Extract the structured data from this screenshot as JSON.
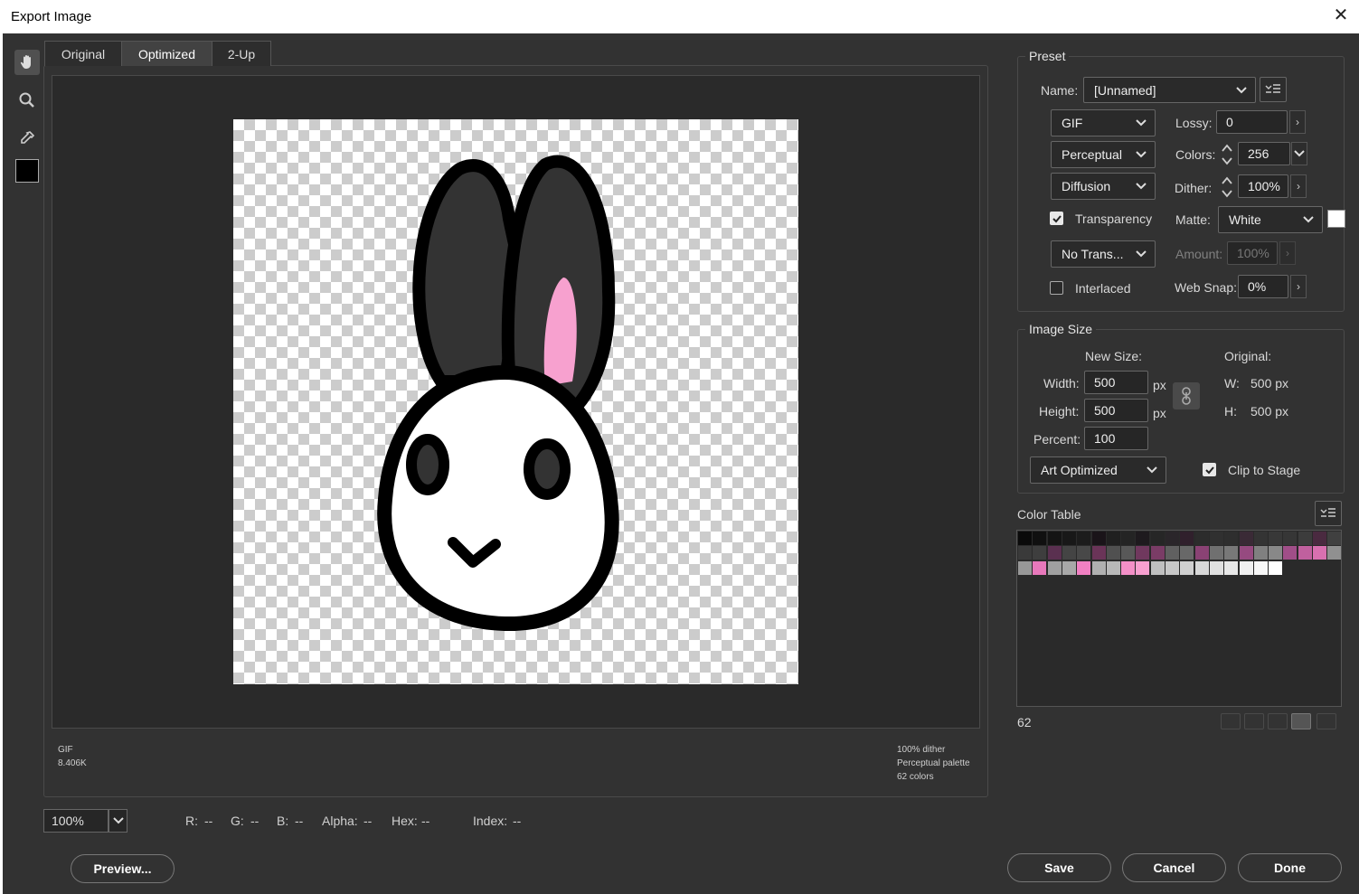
{
  "window": {
    "title": "Export Image",
    "close_glyph": "✕"
  },
  "tabs": [
    {
      "label": "Original",
      "active": false
    },
    {
      "label": "Optimized",
      "active": true
    },
    {
      "label": "2-Up",
      "active": false
    }
  ],
  "tools": [
    "hand-icon",
    "zoom-icon",
    "eyedropper-icon"
  ],
  "preview_info": {
    "left": [
      "GIF",
      "8.406K"
    ],
    "right": [
      "100% dither",
      "Perceptual palette",
      "62 colors"
    ]
  },
  "zoom": {
    "value": "100%"
  },
  "readout": {
    "r": "R:",
    "r_val": "--",
    "g": "G:",
    "g_val": "--",
    "b": "B:",
    "b_val": "--",
    "alpha": "Alpha:",
    "alpha_val": "--",
    "hex": "Hex:",
    "hex_val": "--",
    "index": "Index:",
    "index_val": "--"
  },
  "preset": {
    "legend": "Preset",
    "name_label": "Name:",
    "name_value": "[Unnamed]",
    "format": "GIF",
    "reduction": "Perceptual",
    "dither_algo": "Diffusion",
    "transparency_label": "Transparency",
    "transparency_checked": true,
    "transparency_dither": "No Trans...",
    "interlaced_label": "Interlaced",
    "interlaced_checked": false,
    "lossy_label": "Lossy:",
    "lossy_value": "0",
    "colors_label": "Colors:",
    "colors_value": "256",
    "dither_label": "Dither:",
    "dither_value": "100%",
    "matte_label": "Matte:",
    "matte_value": "White",
    "amount_label": "Amount:",
    "amount_value": "100%",
    "websnap_label": "Web Snap:",
    "websnap_value": "0%"
  },
  "image_size": {
    "legend": "Image Size",
    "new_size_label": "New Size:",
    "original_label": "Original:",
    "width_label": "Width:",
    "width_value": "500",
    "height_label": "Height:",
    "height_value": "500",
    "unit": "px",
    "percent_label": "Percent:",
    "percent_value": "100",
    "orig_w_label": "W:",
    "orig_w_value": "500 px",
    "orig_h_label": "H:",
    "orig_h_value": "500 px",
    "quality": "Art Optimized",
    "clip_label": "Clip to Stage",
    "clip_checked": true
  },
  "color_table": {
    "title": "Color Table",
    "count": "62",
    "colors": [
      "#0a0a0a",
      "#101010",
      "#141414",
      "#181818",
      "#1c1c1c",
      "#1a1419",
      "#202020",
      "#242424",
      "#1e1a1e",
      "#262626",
      "#2a262a",
      "#30202c",
      "#2c2c2c",
      "#303030",
      "#2e2e2e",
      "#3a2a36",
      "#343434",
      "#383838",
      "#363636",
      "#3c3c3c",
      "#4a2a40",
      "#404040",
      "#3a3a3a",
      "#3e3e3e",
      "#5a3050",
      "#444444",
      "#484848",
      "#6a3458",
      "#505050",
      "#585858",
      "#70385e",
      "#7a3c66",
      "#606060",
      "#686868",
      "#8a4274",
      "#707070",
      "#787878",
      "#964a80",
      "#808080",
      "#888888",
      "#a04e88",
      "#c0609e",
      "#d870b0",
      "#909090",
      "#989898",
      "#e878bb",
      "#a0a0a0",
      "#a8a8a8",
      "#f080c2",
      "#b0b0b0",
      "#b8b8b8",
      "#f490c8",
      "#f8a0d0",
      "#c0c0c0",
      "#c8c8c8",
      "#d0d0d0",
      "#d8d8d8",
      "#e0e0e0",
      "#e8e8e8",
      "#f0f0f0",
      "#f8f8f8",
      "#ffffff"
    ]
  },
  "buttons": {
    "preview": "Preview...",
    "save": "Save",
    "cancel": "Cancel",
    "done": "Done"
  }
}
